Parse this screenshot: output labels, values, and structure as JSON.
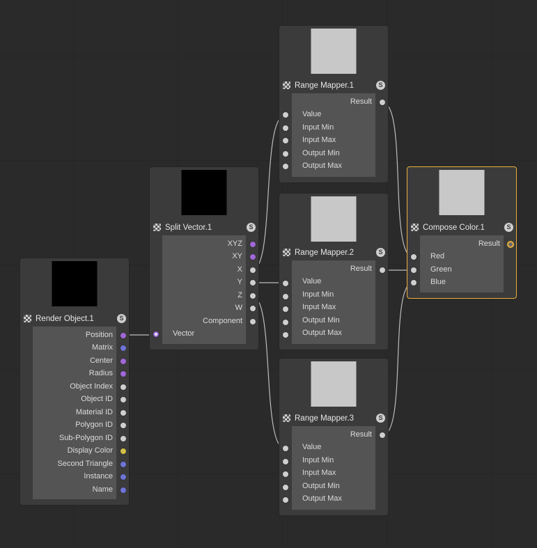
{
  "colors": {
    "canvas_bg": "#2a2a2a",
    "node_bg": "#3b3b3b",
    "node_body": "#545454",
    "selected_border": "#e8b13c",
    "wire": "#bdbdbd",
    "preview_black": "#000000",
    "preview_gray": "#c8c8c8",
    "port_gray": "#cfcfcf",
    "port_purple": "#a067d8",
    "port_blue": "#6e74d8",
    "port_yellow": "#d3c046"
  },
  "nodes": {
    "render_object": {
      "title": "Render Object.1",
      "icon": "material-node-icon",
      "badge": "S",
      "outputs": [
        {
          "label": "Position",
          "color": "purple"
        },
        {
          "label": "Matrix",
          "color": "blue"
        },
        {
          "label": "Center",
          "color": "purple"
        },
        {
          "label": "Radius",
          "color": "purple"
        },
        {
          "label": "Object Index",
          "color": "gray"
        },
        {
          "label": "Object ID",
          "color": "gray"
        },
        {
          "label": "Material ID",
          "color": "gray"
        },
        {
          "label": "Polygon ID",
          "color": "gray"
        },
        {
          "label": "Sub-Polygon ID",
          "color": "gray"
        },
        {
          "label": "Display Color",
          "color": "yellow"
        },
        {
          "label": "Second Triangle",
          "color": "blue"
        },
        {
          "label": "Instance",
          "color": "blue"
        },
        {
          "label": "Name",
          "color": "blue"
        }
      ]
    },
    "split_vector": {
      "title": "Split Vector.1",
      "icon": "material-node-icon",
      "badge": "S",
      "outputs": [
        {
          "label": "XYZ",
          "color": "purple"
        },
        {
          "label": "XY",
          "color": "purple"
        },
        {
          "label": "X",
          "color": "gray"
        },
        {
          "label": "Y",
          "color": "gray"
        },
        {
          "label": "Z",
          "color": "gray"
        },
        {
          "label": "W",
          "color": "gray"
        },
        {
          "label": "Component",
          "color": "gray"
        }
      ],
      "inputs": [
        {
          "label": "Vector",
          "color": "vec"
        }
      ]
    },
    "range_mapper_1": {
      "title": "Range Mapper.1",
      "icon": "material-node-icon",
      "badge": "S",
      "output": "Result",
      "inputs": [
        "Value",
        "Input Min",
        "Input Max",
        "Output Min",
        "Output Max"
      ]
    },
    "range_mapper_2": {
      "title": "Range Mapper.2",
      "icon": "material-node-icon",
      "badge": "S",
      "output": "Result",
      "inputs": [
        "Value",
        "Input Min",
        "Input Max",
        "Output Min",
        "Output Max"
      ]
    },
    "range_mapper_3": {
      "title": "Range Mapper.3",
      "icon": "material-node-icon",
      "badge": "S",
      "output": "Result",
      "inputs": [
        "Value",
        "Input Min",
        "Input Max",
        "Output Min",
        "Output Max"
      ]
    },
    "compose_color": {
      "title": "Compose Color.1",
      "icon": "material-node-icon",
      "badge": "S",
      "output": "Result",
      "inputs": [
        "Red",
        "Green",
        "Blue"
      ]
    }
  }
}
